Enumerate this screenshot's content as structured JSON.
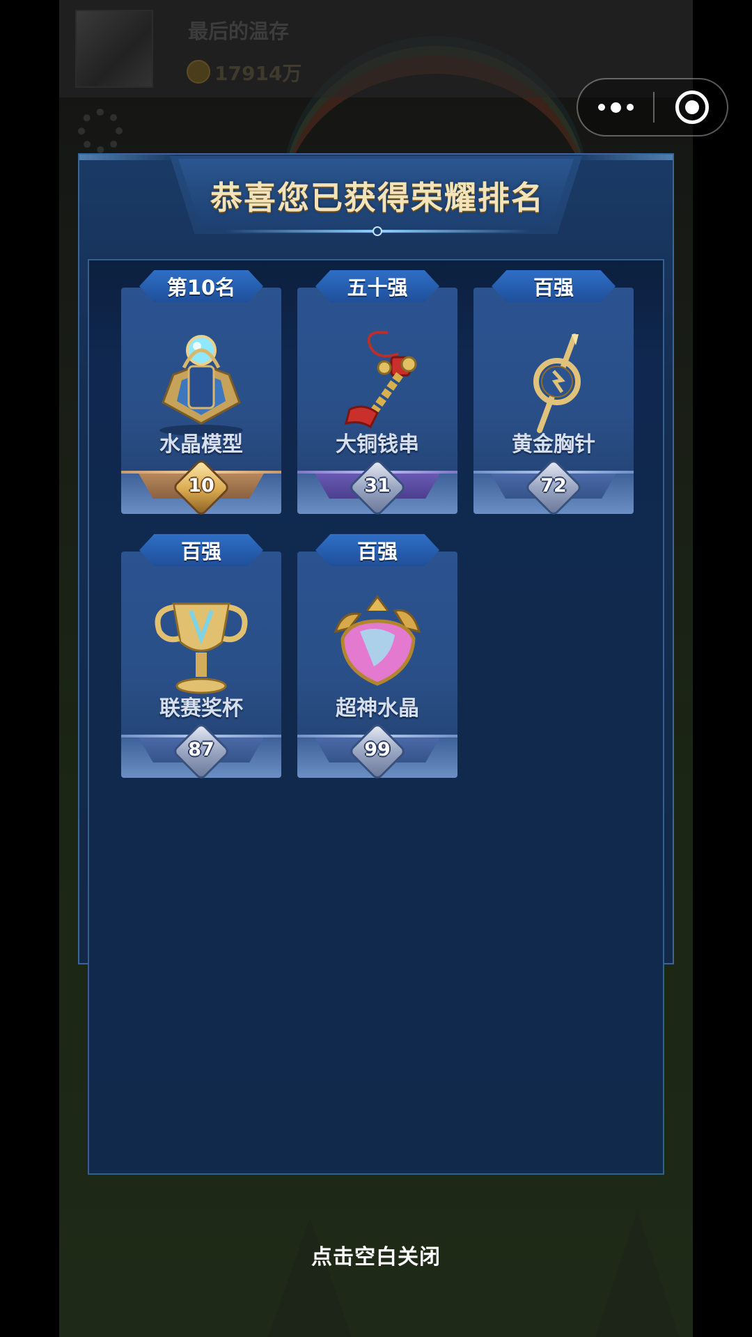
{
  "background": {
    "username": "最后的温存",
    "coins": "17914万"
  },
  "modal": {
    "title": "恭喜您已获得荣耀排名"
  },
  "cards": [
    {
      "tier": "第10名",
      "name": "水晶模型",
      "rank": "10",
      "style": "gold",
      "icon": "crystal-model-icon"
    },
    {
      "tier": "五十强",
      "name": "大铜钱串",
      "rank": "31",
      "style": "purple",
      "icon": "copper-coin-string-icon"
    },
    {
      "tier": "百强",
      "name": "黄金胸针",
      "rank": "72",
      "style": "blue",
      "icon": "golden-brooch-icon"
    },
    {
      "tier": "百强",
      "name": "联赛奖杯",
      "rank": "87",
      "style": "blue",
      "icon": "league-trophy-icon"
    },
    {
      "tier": "百强",
      "name": "超神水晶",
      "rank": "99",
      "style": "blue",
      "icon": "legendary-crystal-icon"
    }
  ],
  "close_hint": "点击空白关闭",
  "colors": {
    "title": "#f3e3b8",
    "panel": "#11294b",
    "gold_base": "#b98a5c",
    "purple_base": "#6a5cb6",
    "blue_base": "#4b6aa8"
  }
}
